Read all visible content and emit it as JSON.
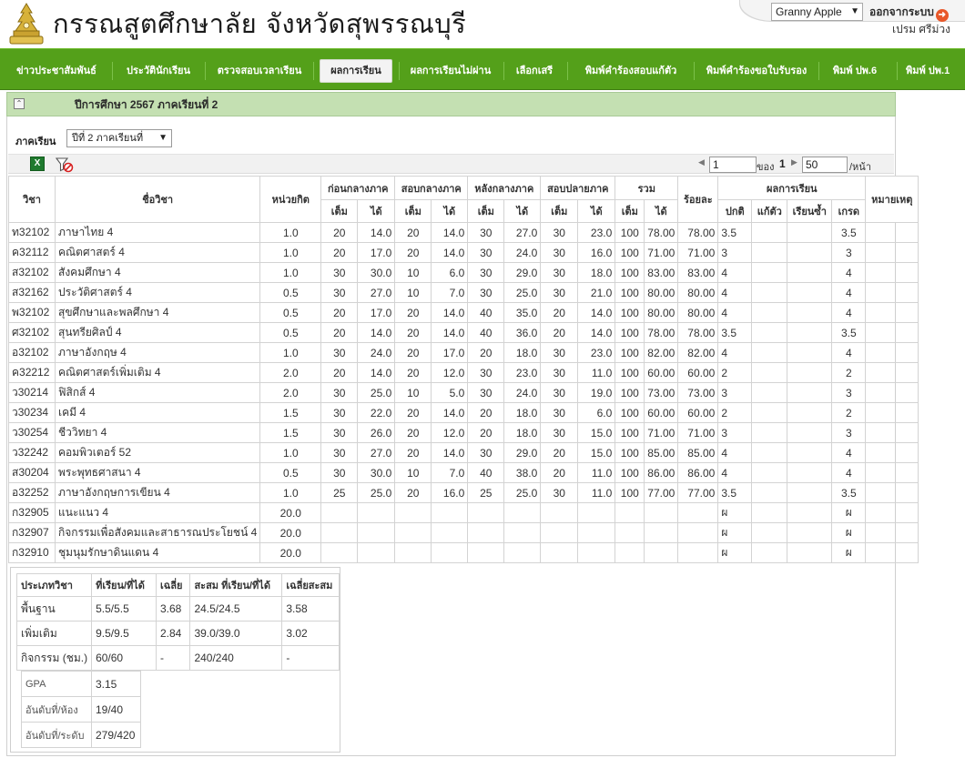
{
  "header": {
    "school_name": "กรรณสูตศึกษาลัย จังหวัดสุพรรณบุรี",
    "user_select": "Granny Apple",
    "logout_label": "ออกจากระบบ",
    "user_fullname": "เปรม ศรีม่วง"
  },
  "nav": [
    "ข่าวประชาสัมพันธ์",
    "ประวัตินักเรียน",
    "ตรวจสอบเวลาเรียน",
    "ผลการเรียน",
    "ผลการเรียนไม่ผ่าน",
    "เลือกเสรี",
    "พิมพ์คำร้องสอบแก้ตัว",
    "พิมพ์คำร้องขอใบรับรอง",
    "พิมพ์ ปพ.6",
    "พิมพ์ ปพ.1"
  ],
  "nav_active": "ผลการเรียน",
  "panel": {
    "title": "ปีการศึกษา 2567 ภาคเรียนที่ 2",
    "term_label": "ภาคเรียน",
    "term_value": "ปีที่ 2 ภาคเรียนที่"
  },
  "pager": {
    "page": "1",
    "of_label": "ของ",
    "total_pages": "1",
    "page_size": "50",
    "per_page_label": "/หน้า"
  },
  "table": {
    "head": {
      "code": "วิชา",
      "name": "ชื่อวิชา",
      "credit": "หน่วยกิต",
      "before_mid": "ก่อนกลางภาค",
      "midterm": "สอบกลางภาค",
      "after_mid": "หลังกลางภาค",
      "final": "สอบปลายภาค",
      "total": "รวม",
      "percent": "ร้อยละ",
      "result": "ผลการเรียน",
      "note": "หมายเหตุ",
      "full": "เต็ม",
      "got": "ได้",
      "normal": "ปกติ",
      "remedial": "แก้ตัว",
      "repeat": "เรียนซ้ำ",
      "grade": "เกรด"
    },
    "rows": [
      [
        "ท32102",
        "ภาษาไทย 4",
        "1.0",
        "20",
        "14.0",
        "20",
        "14.0",
        "30",
        "27.0",
        "30",
        "23.0",
        "100",
        "78.00",
        "78.00",
        "3.5",
        "",
        "",
        "3.5",
        ""
      ],
      [
        "ค32112",
        "คณิตศาสตร์ 4",
        "1.0",
        "20",
        "17.0",
        "20",
        "14.0",
        "30",
        "24.0",
        "30",
        "16.0",
        "100",
        "71.00",
        "71.00",
        "3",
        "",
        "",
        "3",
        ""
      ],
      [
        "ส32102",
        "สังคมศึกษา 4",
        "1.0",
        "30",
        "30.0",
        "10",
        "6.0",
        "30",
        "29.0",
        "30",
        "18.0",
        "100",
        "83.00",
        "83.00",
        "4",
        "",
        "",
        "4",
        ""
      ],
      [
        "ส32162",
        "ประวัติศาสตร์ 4",
        "0.5",
        "30",
        "27.0",
        "10",
        "7.0",
        "30",
        "25.0",
        "30",
        "21.0",
        "100",
        "80.00",
        "80.00",
        "4",
        "",
        "",
        "4",
        ""
      ],
      [
        "พ32102",
        "สุขศึกษาและพลศึกษา 4",
        "0.5",
        "20",
        "17.0",
        "20",
        "14.0",
        "40",
        "35.0",
        "20",
        "14.0",
        "100",
        "80.00",
        "80.00",
        "4",
        "",
        "",
        "4",
        ""
      ],
      [
        "ศ32102",
        "สุนทรียศิลป์ 4",
        "0.5",
        "20",
        "14.0",
        "20",
        "14.0",
        "40",
        "36.0",
        "20",
        "14.0",
        "100",
        "78.00",
        "78.00",
        "3.5",
        "",
        "",
        "3.5",
        ""
      ],
      [
        "อ32102",
        "ภาษาอังกฤษ 4",
        "1.0",
        "30",
        "24.0",
        "20",
        "17.0",
        "20",
        "18.0",
        "30",
        "23.0",
        "100",
        "82.00",
        "82.00",
        "4",
        "",
        "",
        "4",
        ""
      ],
      [
        "ค32212",
        "คณิตศาสตร์เพิ่มเติม 4",
        "2.0",
        "20",
        "14.0",
        "20",
        "12.0",
        "30",
        "23.0",
        "30",
        "11.0",
        "100",
        "60.00",
        "60.00",
        "2",
        "",
        "",
        "2",
        ""
      ],
      [
        "ว30214",
        "ฟิสิกส์ 4",
        "2.0",
        "30",
        "25.0",
        "10",
        "5.0",
        "30",
        "24.0",
        "30",
        "19.0",
        "100",
        "73.00",
        "73.00",
        "3",
        "",
        "",
        "3",
        ""
      ],
      [
        "ว30234",
        "เคมี 4",
        "1.5",
        "30",
        "22.0",
        "20",
        "14.0",
        "20",
        "18.0",
        "30",
        "6.0",
        "100",
        "60.00",
        "60.00",
        "2",
        "",
        "",
        "2",
        ""
      ],
      [
        "ว30254",
        "ชีววิทยา 4",
        "1.5",
        "30",
        "26.0",
        "20",
        "12.0",
        "20",
        "18.0",
        "30",
        "15.0",
        "100",
        "71.00",
        "71.00",
        "3",
        "",
        "",
        "3",
        ""
      ],
      [
        "ว32242",
        "คอมพิวเตอร์ 52",
        "1.0",
        "30",
        "27.0",
        "20",
        "14.0",
        "30",
        "29.0",
        "20",
        "15.0",
        "100",
        "85.00",
        "85.00",
        "4",
        "",
        "",
        "4",
        ""
      ],
      [
        "ส30204",
        "พระพุทธศาสนา 4",
        "0.5",
        "30",
        "30.0",
        "10",
        "7.0",
        "40",
        "38.0",
        "20",
        "11.0",
        "100",
        "86.00",
        "86.00",
        "4",
        "",
        "",
        "4",
        ""
      ],
      [
        "อ32252",
        "ภาษาอังกฤษการเขียน 4",
        "1.0",
        "25",
        "25.0",
        "20",
        "16.0",
        "25",
        "25.0",
        "30",
        "11.0",
        "100",
        "77.00",
        "77.00",
        "3.5",
        "",
        "",
        "3.5",
        ""
      ],
      [
        "ก32905",
        "แนะแนว 4",
        "20.0",
        "",
        "",
        "",
        "",
        "",
        "",
        "",
        "",
        "",
        "",
        "",
        "ผ",
        "",
        "",
        "ผ",
        ""
      ],
      [
        "ก32907",
        "กิจกรรมเพื่อสังคมและสาธารณประโยชน์ 4",
        "20.0",
        "",
        "",
        "",
        "",
        "",
        "",
        "",
        "",
        "",
        "",
        "",
        "ผ",
        "",
        "",
        "ผ",
        ""
      ],
      [
        "ก32910",
        "ชุมนุมรักษาดินแดน 4",
        "20.0",
        "",
        "",
        "",
        "",
        "",
        "",
        "",
        "",
        "",
        "",
        "",
        "ผ",
        "",
        "",
        "ผ",
        ""
      ]
    ]
  },
  "summary": {
    "head": [
      "ประเภทวิชา",
      "ที่เรียน/ที่ได้",
      "เฉลี่ย",
      "สะสม ที่เรียน/ที่ได้",
      "เฉลี่ยสะสม"
    ],
    "rows": [
      [
        "พื้นฐาน",
        "5.5/5.5",
        "3.68",
        "24.5/24.5",
        "3.58"
      ],
      [
        "เพิ่มเติม",
        "9.5/9.5",
        "2.84",
        "39.0/39.0",
        "3.02"
      ],
      [
        "กิจกรรม (ชม.)",
        "60/60",
        "-",
        "240/240",
        "-"
      ]
    ],
    "gpa_label": "GPA",
    "gpa": "3.15",
    "class_rank_label": "อันดับที่/ห้อง",
    "class_rank": "19/40",
    "level_rank_label": "อันดับที่/ระดับ",
    "level_rank": "279/420"
  },
  "colors": {
    "nav_bg": "#54a01a",
    "panel_head_bg": "#c4e0b2",
    "excel_green": "#1f7a2e",
    "logout_orange": "#e8582a"
  },
  "icons": [
    "school-emblem-icon",
    "chevron-down-icon",
    "logout-arrow-icon",
    "collapse-icon",
    "excel-export-icon",
    "clear-filter-icon",
    "pager-prev-icon",
    "pager-next-icon"
  ]
}
